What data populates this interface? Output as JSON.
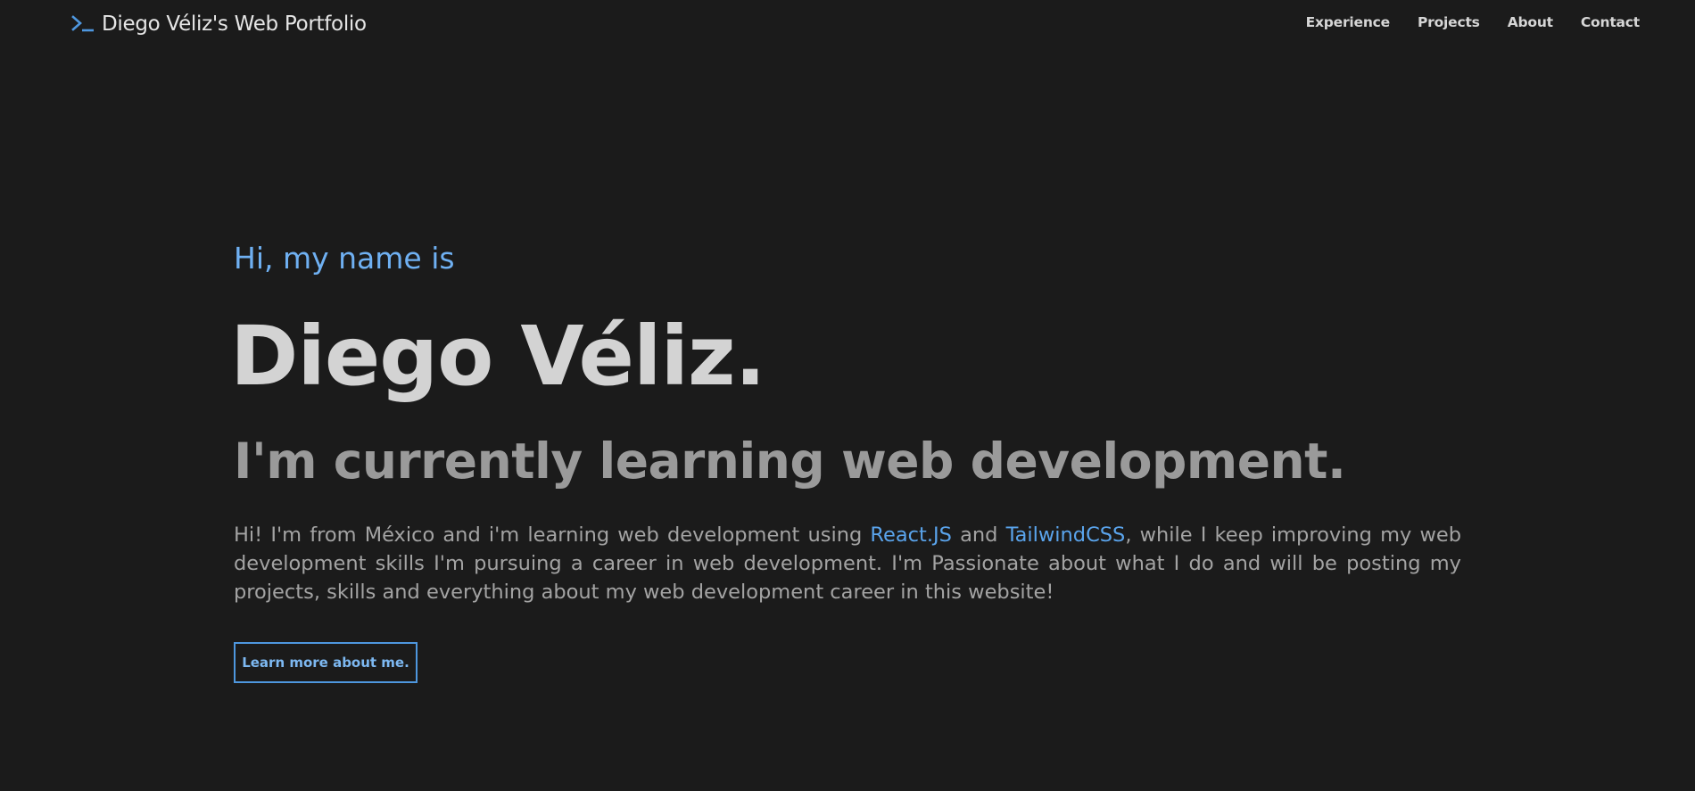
{
  "header": {
    "brand_icon": "terminal-prompt-icon",
    "brand_title": "Diego Véliz's Web Portfolio",
    "accent_color": "#4e97df",
    "nav": [
      {
        "label": "Experience"
      },
      {
        "label": "Projects"
      },
      {
        "label": "About"
      },
      {
        "label": "Contact"
      }
    ]
  },
  "hero": {
    "greeting": "Hi, my name is",
    "name": "Diego Véliz.",
    "tagline": "I'm currently learning web development.",
    "description": {
      "part1": "Hi! I'm from México and i'm learning web development using ",
      "link1": "React.JS",
      "part2": " and ",
      "link2": "TailwindCSS",
      "part3": ", while I keep improving my web development skills I'm pursuing a career in web development. I'm Passionate about what I do and will be posting my projects, skills and everything about my web development career in this website!"
    },
    "cta_label": "Learn more about me."
  }
}
